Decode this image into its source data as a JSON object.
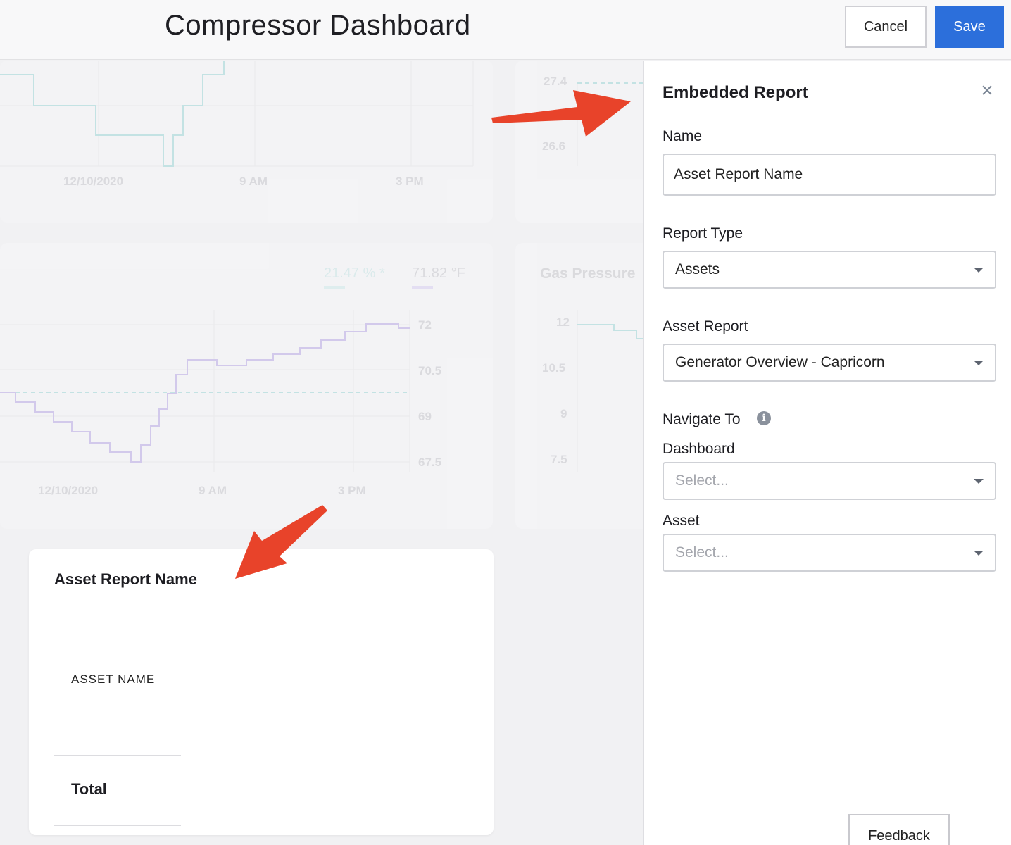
{
  "header": {
    "title": "Compressor Dashboard",
    "cancel_label": "Cancel",
    "save_label": "Save"
  },
  "widgets": {
    "top_left": {
      "x_ticks": [
        "12/10/2020",
        "9 AM",
        "3 PM"
      ]
    },
    "top_right": {
      "y_ticks": [
        "27.4",
        "26.6"
      ]
    },
    "mid_left": {
      "legend": [
        {
          "label": "21.47 % *",
          "color": "#9fd6d6"
        },
        {
          "label": "71.82 °F",
          "color": "#b9a9e6"
        }
      ],
      "y_ticks": [
        "72",
        "70.5",
        "69",
        "67.5"
      ],
      "x_ticks": [
        "12/10/2020",
        "9 AM",
        "3 PM"
      ]
    },
    "mid_right": {
      "title": "Gas Pressure",
      "y_ticks": [
        "12",
        "10.5",
        "9",
        "7.5"
      ]
    }
  },
  "report_card": {
    "title": "Asset Report Name",
    "column_header": "ASSET NAME",
    "total_label": "Total"
  },
  "panel": {
    "title": "Embedded Report",
    "name_label": "Name",
    "name_value": "Asset Report Name",
    "report_type_label": "Report Type",
    "report_type_value": "Assets",
    "asset_report_label": "Asset Report",
    "asset_report_value": "Generator Overview - Capricorn",
    "navigate_label": "Navigate To",
    "dashboard_label": "Dashboard",
    "dashboard_placeholder": "Select...",
    "asset_label": "Asset",
    "asset_placeholder": "Select...",
    "feedback_label": "Feedback"
  },
  "colors": {
    "accent": "#2c6fdb",
    "annotation_arrow": "#e8432a"
  }
}
